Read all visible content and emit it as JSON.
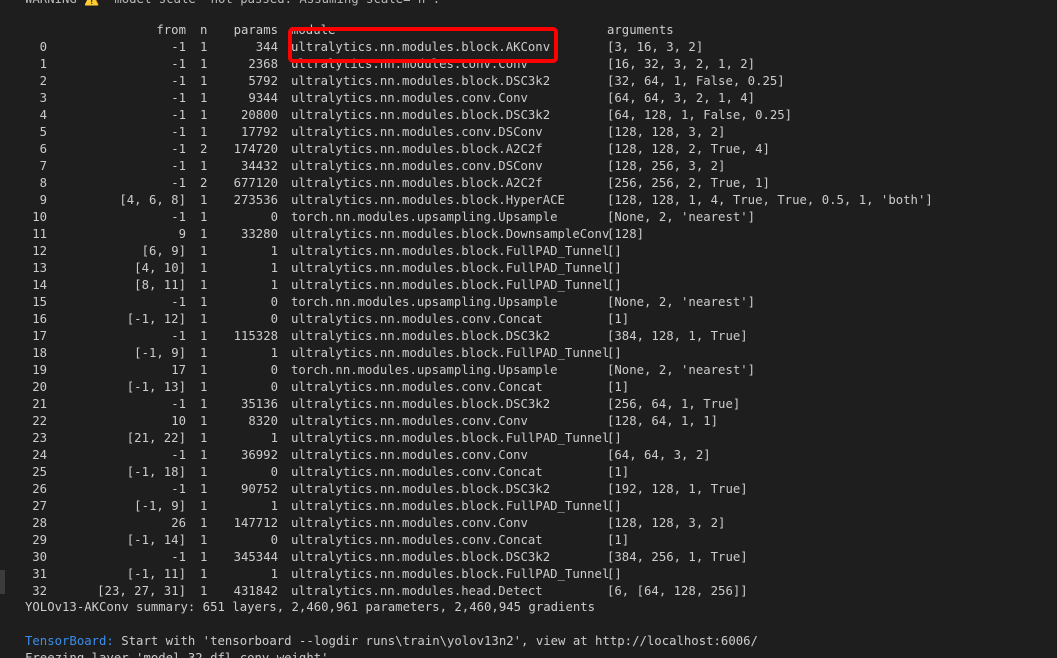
{
  "top_clip": "WARNING ⚠️ 'model scale' not passed. Assuming scale='n'.",
  "header": {
    "from": "from",
    "n": "n",
    "params": "params",
    "module": "module",
    "arguments": "arguments"
  },
  "rows": [
    {
      "idx": "0",
      "from": "-1",
      "n": "1",
      "params": "344",
      "module": "ultralytics.nn.modules.block.AKConv",
      "args": "[3, 16, 3, 2]"
    },
    {
      "idx": "1",
      "from": "-1",
      "n": "1",
      "params": "2368",
      "module": "ultralytics.nn.modules.conv.Conv",
      "args": "[16, 32, 3, 2, 1, 2]"
    },
    {
      "idx": "2",
      "from": "-1",
      "n": "1",
      "params": "5792",
      "module": "ultralytics.nn.modules.block.DSC3k2",
      "args": "[32, 64, 1, False, 0.25]"
    },
    {
      "idx": "3",
      "from": "-1",
      "n": "1",
      "params": "9344",
      "module": "ultralytics.nn.modules.conv.Conv",
      "args": "[64, 64, 3, 2, 1, 4]"
    },
    {
      "idx": "4",
      "from": "-1",
      "n": "1",
      "params": "20800",
      "module": "ultralytics.nn.modules.block.DSC3k2",
      "args": "[64, 128, 1, False, 0.25]"
    },
    {
      "idx": "5",
      "from": "-1",
      "n": "1",
      "params": "17792",
      "module": "ultralytics.nn.modules.conv.DSConv",
      "args": "[128, 128, 3, 2]"
    },
    {
      "idx": "6",
      "from": "-1",
      "n": "2",
      "params": "174720",
      "module": "ultralytics.nn.modules.block.A2C2f",
      "args": "[128, 128, 2, True, 4]"
    },
    {
      "idx": "7",
      "from": "-1",
      "n": "1",
      "params": "34432",
      "module": "ultralytics.nn.modules.conv.DSConv",
      "args": "[128, 256, 3, 2]"
    },
    {
      "idx": "8",
      "from": "-1",
      "n": "2",
      "params": "677120",
      "module": "ultralytics.nn.modules.block.A2C2f",
      "args": "[256, 256, 2, True, 1]"
    },
    {
      "idx": "9",
      "from": "[4, 6, 8]",
      "n": "1",
      "params": "273536",
      "module": "ultralytics.nn.modules.block.HyperACE",
      "args": "[128, 128, 1, 4, True, True, 0.5, 1, 'both']"
    },
    {
      "idx": "10",
      "from": "-1",
      "n": "1",
      "params": "0",
      "module": "torch.nn.modules.upsampling.Upsample",
      "args": "[None, 2, 'nearest']"
    },
    {
      "idx": "11",
      "from": "9",
      "n": "1",
      "params": "33280",
      "module": "ultralytics.nn.modules.block.DownsampleConv",
      "args": "[128]"
    },
    {
      "idx": "12",
      "from": "[6, 9]",
      "n": "1",
      "params": "1",
      "module": "ultralytics.nn.modules.block.FullPAD_Tunnel",
      "args": "[]"
    },
    {
      "idx": "13",
      "from": "[4, 10]",
      "n": "1",
      "params": "1",
      "module": "ultralytics.nn.modules.block.FullPAD_Tunnel",
      "args": "[]"
    },
    {
      "idx": "14",
      "from": "[8, 11]",
      "n": "1",
      "params": "1",
      "module": "ultralytics.nn.modules.block.FullPAD_Tunnel",
      "args": "[]"
    },
    {
      "idx": "15",
      "from": "-1",
      "n": "1",
      "params": "0",
      "module": "torch.nn.modules.upsampling.Upsample",
      "args": "[None, 2, 'nearest']"
    },
    {
      "idx": "16",
      "from": "[-1, 12]",
      "n": "1",
      "params": "0",
      "module": "ultralytics.nn.modules.conv.Concat",
      "args": "[1]"
    },
    {
      "idx": "17",
      "from": "-1",
      "n": "1",
      "params": "115328",
      "module": "ultralytics.nn.modules.block.DSC3k2",
      "args": "[384, 128, 1, True]"
    },
    {
      "idx": "18",
      "from": "[-1, 9]",
      "n": "1",
      "params": "1",
      "module": "ultralytics.nn.modules.block.FullPAD_Tunnel",
      "args": "[]"
    },
    {
      "idx": "19",
      "from": "17",
      "n": "1",
      "params": "0",
      "module": "torch.nn.modules.upsampling.Upsample",
      "args": "[None, 2, 'nearest']"
    },
    {
      "idx": "20",
      "from": "[-1, 13]",
      "n": "1",
      "params": "0",
      "module": "ultralytics.nn.modules.conv.Concat",
      "args": "[1]"
    },
    {
      "idx": "21",
      "from": "-1",
      "n": "1",
      "params": "35136",
      "module": "ultralytics.nn.modules.block.DSC3k2",
      "args": "[256, 64, 1, True]"
    },
    {
      "idx": "22",
      "from": "10",
      "n": "1",
      "params": "8320",
      "module": "ultralytics.nn.modules.conv.Conv",
      "args": "[128, 64, 1, 1]"
    },
    {
      "idx": "23",
      "from": "[21, 22]",
      "n": "1",
      "params": "1",
      "module": "ultralytics.nn.modules.block.FullPAD_Tunnel",
      "args": "[]"
    },
    {
      "idx": "24",
      "from": "-1",
      "n": "1",
      "params": "36992",
      "module": "ultralytics.nn.modules.conv.Conv",
      "args": "[64, 64, 3, 2]"
    },
    {
      "idx": "25",
      "from": "[-1, 18]",
      "n": "1",
      "params": "0",
      "module": "ultralytics.nn.modules.conv.Concat",
      "args": "[1]"
    },
    {
      "idx": "26",
      "from": "-1",
      "n": "1",
      "params": "90752",
      "module": "ultralytics.nn.modules.block.DSC3k2",
      "args": "[192, 128, 1, True]"
    },
    {
      "idx": "27",
      "from": "[-1, 9]",
      "n": "1",
      "params": "1",
      "module": "ultralytics.nn.modules.block.FullPAD_Tunnel",
      "args": "[]"
    },
    {
      "idx": "28",
      "from": "26",
      "n": "1",
      "params": "147712",
      "module": "ultralytics.nn.modules.conv.Conv",
      "args": "[128, 128, 3, 2]"
    },
    {
      "idx": "29",
      "from": "[-1, 14]",
      "n": "1",
      "params": "0",
      "module": "ultralytics.nn.modules.conv.Concat",
      "args": "[1]"
    },
    {
      "idx": "30",
      "from": "-1",
      "n": "1",
      "params": "345344",
      "module": "ultralytics.nn.modules.block.DSC3k2",
      "args": "[384, 256, 1, True]"
    },
    {
      "idx": "31",
      "from": "[-1, 11]",
      "n": "1",
      "params": "1",
      "module": "ultralytics.nn.modules.block.FullPAD_Tunnel",
      "args": "[]"
    },
    {
      "idx": "32",
      "from": "[23, 27, 31]",
      "n": "1",
      "params": "431842",
      "module": "ultralytics.nn.modules.head.Detect",
      "args": "[6, [64, 128, 256]]"
    }
  ],
  "summary": "YOLOv13-AKConv summary: 651 layers, 2,460,961 parameters, 2,460,945 gradients",
  "tensorboard": {
    "label": "TensorBoard:",
    "text": " Start with 'tensorboard --logdir runs\\train\\yolov13n2', view at http://localhost:6006/"
  },
  "bottom_clip": "Freezing layer 'model.32.dfl.conv.weight'"
}
